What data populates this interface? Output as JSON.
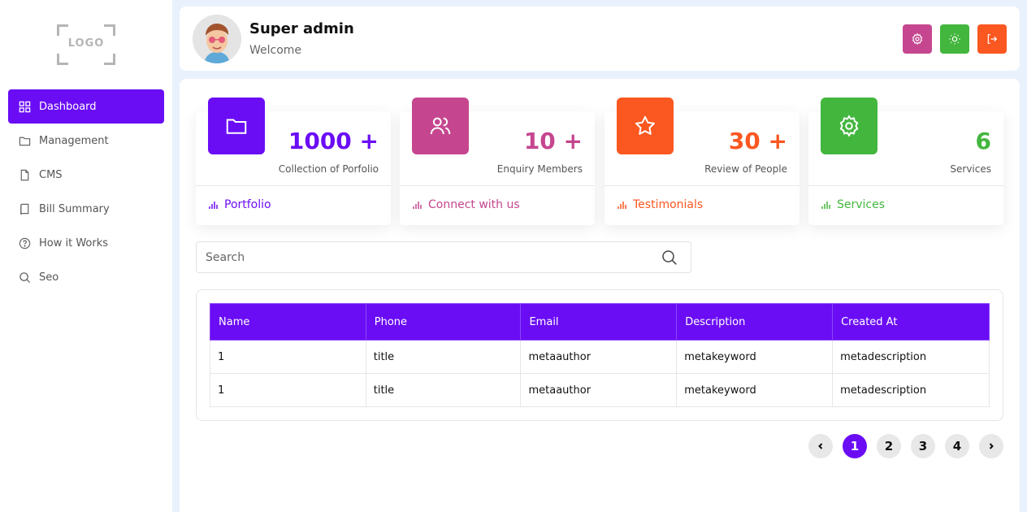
{
  "sidebar": {
    "logo_text": "LOGO",
    "items": [
      {
        "label": "Dashboard",
        "icon": "grid-icon",
        "active": true
      },
      {
        "label": "Management",
        "icon": "folder-icon"
      },
      {
        "label": "CMS",
        "icon": "file-icon"
      },
      {
        "label": "Bill Summary",
        "icon": "book-icon"
      },
      {
        "label": "How it Works",
        "icon": "help-circle-icon"
      },
      {
        "label": "Seo",
        "icon": "search-icon"
      }
    ]
  },
  "header": {
    "title": "Super admin",
    "subtitle": "Welcome",
    "buttons": [
      {
        "icon": "gear-icon",
        "color": "#c5468f"
      },
      {
        "icon": "sun-icon",
        "color": "#43b63e"
      },
      {
        "icon": "logout-icon",
        "color": "#fb5720"
      }
    ]
  },
  "cards": [
    {
      "value": "1000 +",
      "label": "Collection of Porfolio",
      "link": "Portfolio",
      "color": "#6a0df5",
      "icon": "folder-icon"
    },
    {
      "value": "10 +",
      "label": "Enquiry Members",
      "link": "Connect with us",
      "color": "#c5468f",
      "icon": "users-icon"
    },
    {
      "value": "30 +",
      "label": "Review of People",
      "link": "Testimonials",
      "color": "#fb5720",
      "icon": "star-icon"
    },
    {
      "value": "6",
      "label": "Services",
      "link": "Services",
      "color": "#43b63e",
      "icon": "gear-icon"
    }
  ],
  "search": {
    "placeholder": "Search"
  },
  "table": {
    "headers": [
      "Name",
      "Phone",
      "Email",
      "Description",
      "Created At"
    ],
    "rows": [
      [
        "1",
        "title",
        "metaauthor",
        "metakeyword",
        "metadescription"
      ],
      [
        "1",
        "title",
        "metaauthor",
        "metakeyword",
        "metadescription"
      ]
    ]
  },
  "pagination": {
    "pages": [
      "1",
      "2",
      "3",
      "4"
    ],
    "current": "1",
    "accent": "#6a0df5"
  }
}
